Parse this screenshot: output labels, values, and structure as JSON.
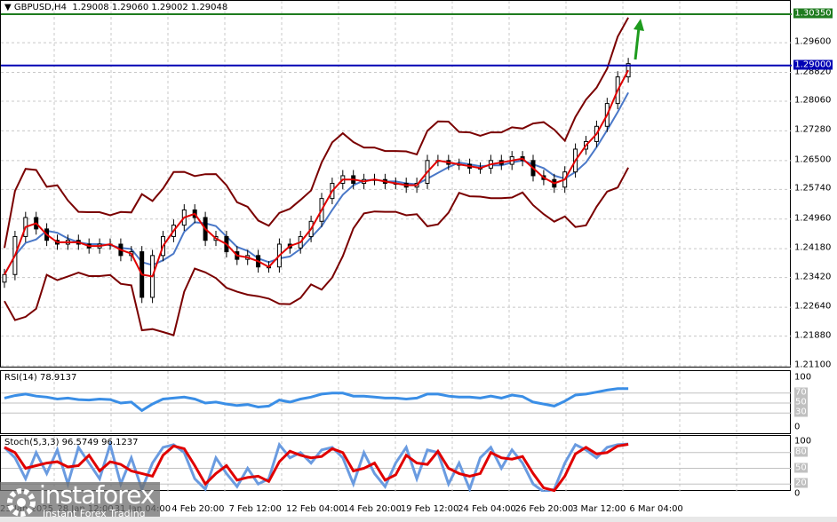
{
  "header": {
    "symbol": "GBPUSD,H4",
    "ohlc": "1.29008 1.29060 1.29002 1.29048"
  },
  "price_axis": [
    "1.29600",
    "1.28820",
    "1.28060",
    "1.27280",
    "1.26500",
    "1.25740",
    "1.24960",
    "1.24180",
    "1.23420",
    "1.22640",
    "1.21880",
    "1.21100"
  ],
  "levels": {
    "target": {
      "label": "1.30350",
      "value": 1.3035,
      "color": "#1e7b1e"
    },
    "current": {
      "label": "1.29000",
      "value": 1.29,
      "color": "#0000b4"
    }
  },
  "rsi": {
    "label": "RSI(14) 78.9137",
    "levels": [
      "70",
      "50",
      "30"
    ],
    "max": "100",
    "min": "0"
  },
  "stoch": {
    "label": "Stoch(5,3,3) 96.5749 96.1237",
    "levels": [
      "80",
      "50",
      "20"
    ],
    "max": "100",
    "min": "0"
  },
  "dates": [
    "23 Jan 2025",
    "28 Jan 12:00",
    "31 Jan 04:00",
    "4 Feb 20:00",
    "7 Feb 12:00",
    "12 Feb 04:00",
    "14 Feb 20:00",
    "19 Feb 12:00",
    "24 Feb 04:00",
    "26 Feb 20:00",
    "3 Mar 12:00",
    "6 Mar 04:00"
  ],
  "logo": {
    "name": "instaforex",
    "tagline": "Instant Forex Trading"
  },
  "chart_data": {
    "type": "candlestick",
    "ylim": [
      1.211,
      1.3035
    ],
    "closes": [
      1.235,
      1.245,
      1.25,
      1.247,
      1.244,
      1.243,
      1.244,
      1.243,
      1.242,
      1.243,
      1.243,
      1.24,
      1.241,
      1.229,
      1.24,
      1.245,
      1.248,
      1.252,
      1.25,
      1.244,
      1.245,
      1.241,
      1.239,
      1.24,
      1.237,
      1.237,
      1.243,
      1.242,
      1.245,
      1.249,
      1.255,
      1.259,
      1.261,
      1.259,
      1.26,
      1.26,
      1.259,
      1.259,
      1.258,
      1.259,
      1.265,
      1.265,
      1.264,
      1.264,
      1.263,
      1.263,
      1.265,
      1.264,
      1.266,
      1.265,
      1.261,
      1.26,
      1.258,
      1.262,
      1.268,
      1.27,
      1.274,
      1.28,
      1.287,
      1.2905
    ],
    "rsi": [
      60,
      65,
      68,
      64,
      62,
      58,
      60,
      57,
      56,
      58,
      57,
      50,
      52,
      35,
      48,
      58,
      60,
      62,
      58,
      50,
      52,
      48,
      45,
      47,
      42,
      44,
      56,
      52,
      58,
      62,
      68,
      70,
      70,
      64,
      64,
      62,
      60,
      60,
      58,
      60,
      68,
      68,
      64,
      62,
      62,
      60,
      64,
      60,
      66,
      63,
      52,
      48,
      44,
      54,
      66,
      68,
      72,
      76,
      79,
      78.9
    ],
    "stoch": [
      90,
      70,
      30,
      80,
      40,
      85,
      20,
      90,
      60,
      30,
      95,
      20,
      70,
      10,
      60,
      90,
      95,
      80,
      30,
      10,
      70,
      40,
      15,
      50,
      20,
      30,
      95,
      70,
      80,
      60,
      85,
      90,
      70,
      20,
      80,
      40,
      15,
      60,
      90,
      30,
      85,
      80,
      20,
      60,
      10,
      70,
      90,
      50,
      85,
      60,
      20,
      5,
      10,
      60,
      95,
      85,
      70,
      90,
      95,
      96.5
    ]
  }
}
